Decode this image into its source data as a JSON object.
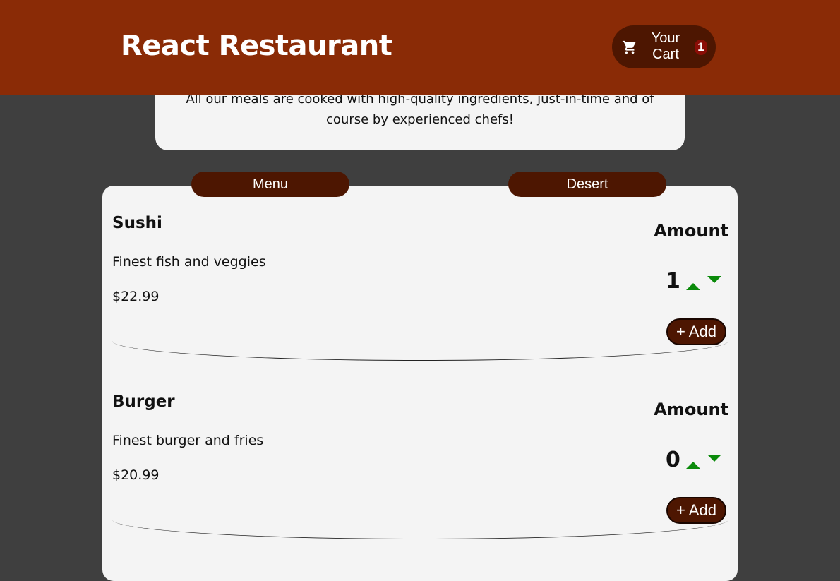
{
  "header": {
    "title": "React Restaurant",
    "cart_label": "Your Cart",
    "cart_count": "1"
  },
  "summary": {
    "text": "All our meals are cooked with high-quality ingredients, just-in-time and of course by experienced chefs!"
  },
  "tabs": [
    {
      "label": "Menu"
    },
    {
      "label": "Desert"
    }
  ],
  "meals": [
    {
      "name": "Sushi",
      "description": "Finest fish and veggies",
      "price": "$22.99",
      "amount_label": "Amount",
      "amount": "1",
      "add_label": "+ Add"
    },
    {
      "name": "Burger",
      "description": "Finest burger and fries",
      "price": "$20.99",
      "amount_label": "Amount",
      "amount": "0",
      "add_label": "+ Add"
    }
  ],
  "colors": {
    "header": "#8a2b06",
    "button": "#4d1601",
    "background": "#3f3f3f",
    "card": "#f4f4f4",
    "arrow": "#0a8a0a"
  },
  "icons": {
    "cart": "cart-icon",
    "increment": "arrow-up-icon",
    "decrement": "arrow-down-icon"
  }
}
